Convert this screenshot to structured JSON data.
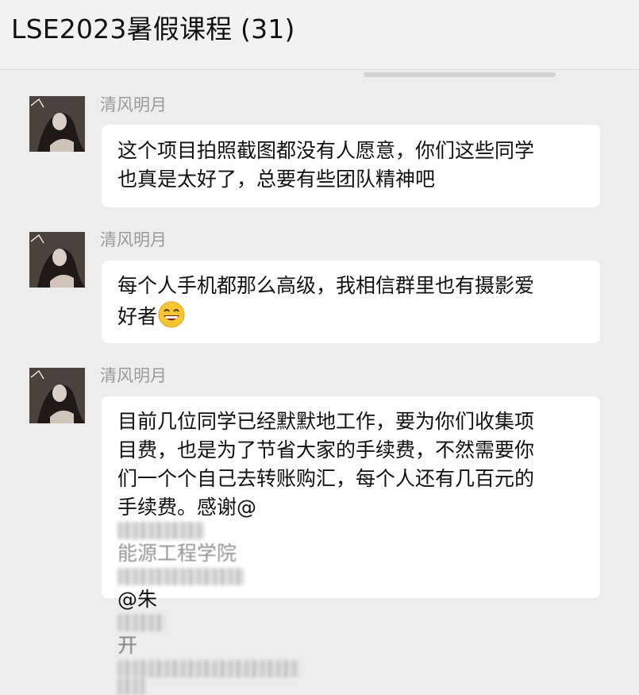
{
  "header": {
    "title": "LSE2023暑假课程 (31)"
  },
  "messages": [
    {
      "sender": "清风明月",
      "lines": [
        "这个项目拍照截图都没有人愿意，你们这些同学",
        "也真是太好了，总要有些团队精神吧"
      ]
    },
    {
      "sender": "清风明月",
      "line1": "每个人手机都那么高级，我相信群里也有摄影爱",
      "line2": "好者",
      "emoji": "grinning-face-emoji"
    },
    {
      "sender": "清风明月",
      "lines": [
        "目前几位同学已经默默地工作，要为你们收集项",
        "目费，也是为了节省大家的手续费，不然需要你",
        "们一个个自己去转账购汇，每个人还有几百元的"
      ],
      "line4_prefix": "手续费。感谢@",
      "line4_visible": "能源工程学院",
      "line5_mention": "@朱",
      "line5_mid": "开"
    }
  ]
}
